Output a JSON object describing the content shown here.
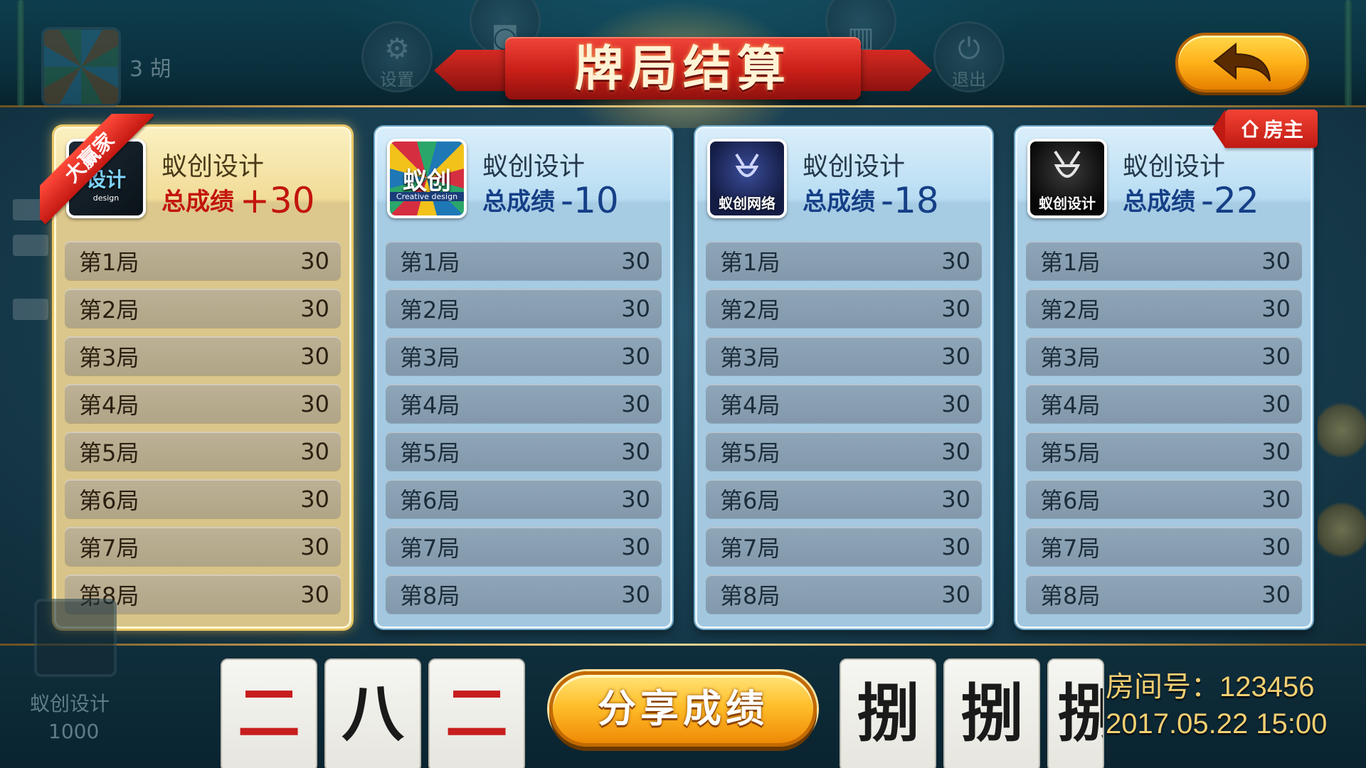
{
  "title": "牌局结算",
  "topbar": {
    "hu_text": "3 胡",
    "settings_label": "设置",
    "exit_label": "退出"
  },
  "badges": {
    "winner": "大赢家",
    "owner": "房主"
  },
  "players": [
    {
      "name": "蚁创设计",
      "total_label": "总成绩",
      "total": "+30",
      "avatar_text": "设计",
      "avatar_sub": "design",
      "is_winner": true,
      "rounds": [
        {
          "label": "第1局",
          "score": "30"
        },
        {
          "label": "第2局",
          "score": "30"
        },
        {
          "label": "第3局",
          "score": "30"
        },
        {
          "label": "第4局",
          "score": "30"
        },
        {
          "label": "第5局",
          "score": "30"
        },
        {
          "label": "第6局",
          "score": "30"
        },
        {
          "label": "第7局",
          "score": "30"
        },
        {
          "label": "第8局",
          "score": "30"
        }
      ]
    },
    {
      "name": "蚁创设计",
      "total_label": "总成绩",
      "total": "-10",
      "avatar_text": "蚁创",
      "avatar_sub": "Creative design",
      "rounds": [
        {
          "label": "第1局",
          "score": "30"
        },
        {
          "label": "第2局",
          "score": "30"
        },
        {
          "label": "第3局",
          "score": "30"
        },
        {
          "label": "第4局",
          "score": "30"
        },
        {
          "label": "第5局",
          "score": "30"
        },
        {
          "label": "第6局",
          "score": "30"
        },
        {
          "label": "第7局",
          "score": "30"
        },
        {
          "label": "第8局",
          "score": "30"
        }
      ]
    },
    {
      "name": "蚁创设计",
      "total_label": "总成绩",
      "total": "-18",
      "avatar_text": "蚁创网络",
      "rounds": [
        {
          "label": "第1局",
          "score": "30"
        },
        {
          "label": "第2局",
          "score": "30"
        },
        {
          "label": "第3局",
          "score": "30"
        },
        {
          "label": "第4局",
          "score": "30"
        },
        {
          "label": "第5局",
          "score": "30"
        },
        {
          "label": "第6局",
          "score": "30"
        },
        {
          "label": "第7局",
          "score": "30"
        },
        {
          "label": "第8局",
          "score": "30"
        }
      ]
    },
    {
      "name": "蚁创设计",
      "total_label": "总成绩",
      "total": "-22",
      "avatar_text": "蚁创设计",
      "is_owner": true,
      "rounds": [
        {
          "label": "第1局",
          "score": "30"
        },
        {
          "label": "第2局",
          "score": "30"
        },
        {
          "label": "第3局",
          "score": "30"
        },
        {
          "label": "第4局",
          "score": "30"
        },
        {
          "label": "第5局",
          "score": "30"
        },
        {
          "label": "第6局",
          "score": "30"
        },
        {
          "label": "第7局",
          "score": "30"
        },
        {
          "label": "第8局",
          "score": "30"
        }
      ]
    }
  ],
  "share_button": "分享成绩",
  "room": {
    "label": "房间号：123456",
    "datetime": "2017.05.22 15:00"
  },
  "bottom_player": {
    "name": "蚁创设计",
    "score": "1000"
  },
  "tiles": [
    "二",
    "八",
    "二",
    "捌",
    "捌",
    "捌"
  ],
  "colors": {
    "ribbon": "#c81e18",
    "gold_panel": "#f1dc98",
    "blue_panel": "#b8dcf2",
    "winner_total": "#c2150e",
    "normal_total": "#153f86",
    "share_button": "#ffbf2a",
    "room_text": "#f3cf73"
  }
}
